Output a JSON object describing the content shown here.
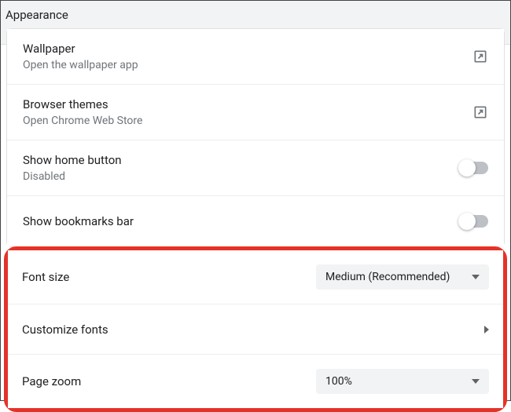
{
  "header": {
    "title": "Appearance"
  },
  "rows": {
    "wallpaper": {
      "title": "Wallpaper",
      "sub": "Open the wallpaper app"
    },
    "themes": {
      "title": "Browser themes",
      "sub": "Open Chrome Web Store"
    },
    "home": {
      "title": "Show home button",
      "sub": "Disabled"
    },
    "bookmarks": {
      "title": "Show bookmarks bar"
    },
    "fontsize": {
      "title": "Font size",
      "value": "Medium (Recommended)"
    },
    "customfonts": {
      "title": "Customize fonts"
    },
    "pagezoom": {
      "title": "Page zoom",
      "value": "100%"
    }
  }
}
